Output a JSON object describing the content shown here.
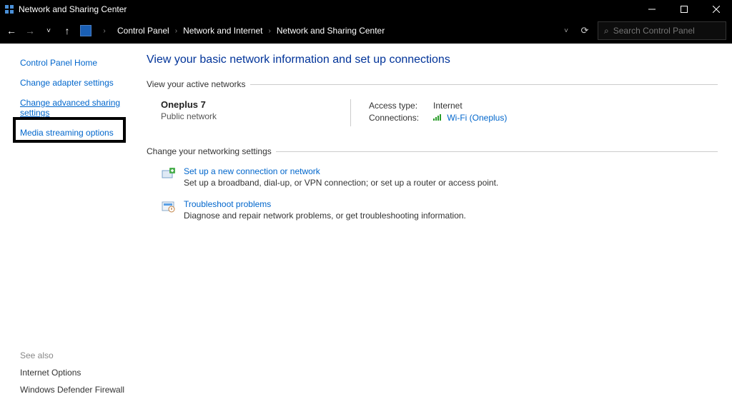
{
  "window": {
    "title": "Network and Sharing Center"
  },
  "toolbar": {
    "breadcrumb": [
      "Control Panel",
      "Network and Internet",
      "Network and Sharing Center"
    ],
    "search_placeholder": "Search Control Panel"
  },
  "sidebar": {
    "links": [
      {
        "label": "Control Panel Home",
        "highlight": false
      },
      {
        "label": "Change adapter settings",
        "highlight": false
      },
      {
        "label": "Change advanced sharing settings",
        "highlight": true
      },
      {
        "label": "Media streaming options",
        "highlight": false
      }
    ],
    "see_also_title": "See also",
    "footer_links": [
      {
        "label": "Internet Options"
      },
      {
        "label": "Windows Defender Firewall"
      }
    ]
  },
  "main": {
    "heading": "View your basic network information and set up connections",
    "active_section_title": "View your active networks",
    "network": {
      "name": "Oneplus 7",
      "type": "Public network",
      "access_label": "Access type:",
      "access_value": "Internet",
      "connections_label": "Connections:",
      "connections_value": "Wi-Fi (Oneplus)"
    },
    "settings_section_title": "Change your networking settings",
    "settings": [
      {
        "title": "Set up a new connection or network",
        "desc": "Set up a broadband, dial-up, or VPN connection; or set up a router or access point."
      },
      {
        "title": "Troubleshoot problems",
        "desc": "Diagnose and repair network problems, or get troubleshooting information."
      }
    ]
  }
}
